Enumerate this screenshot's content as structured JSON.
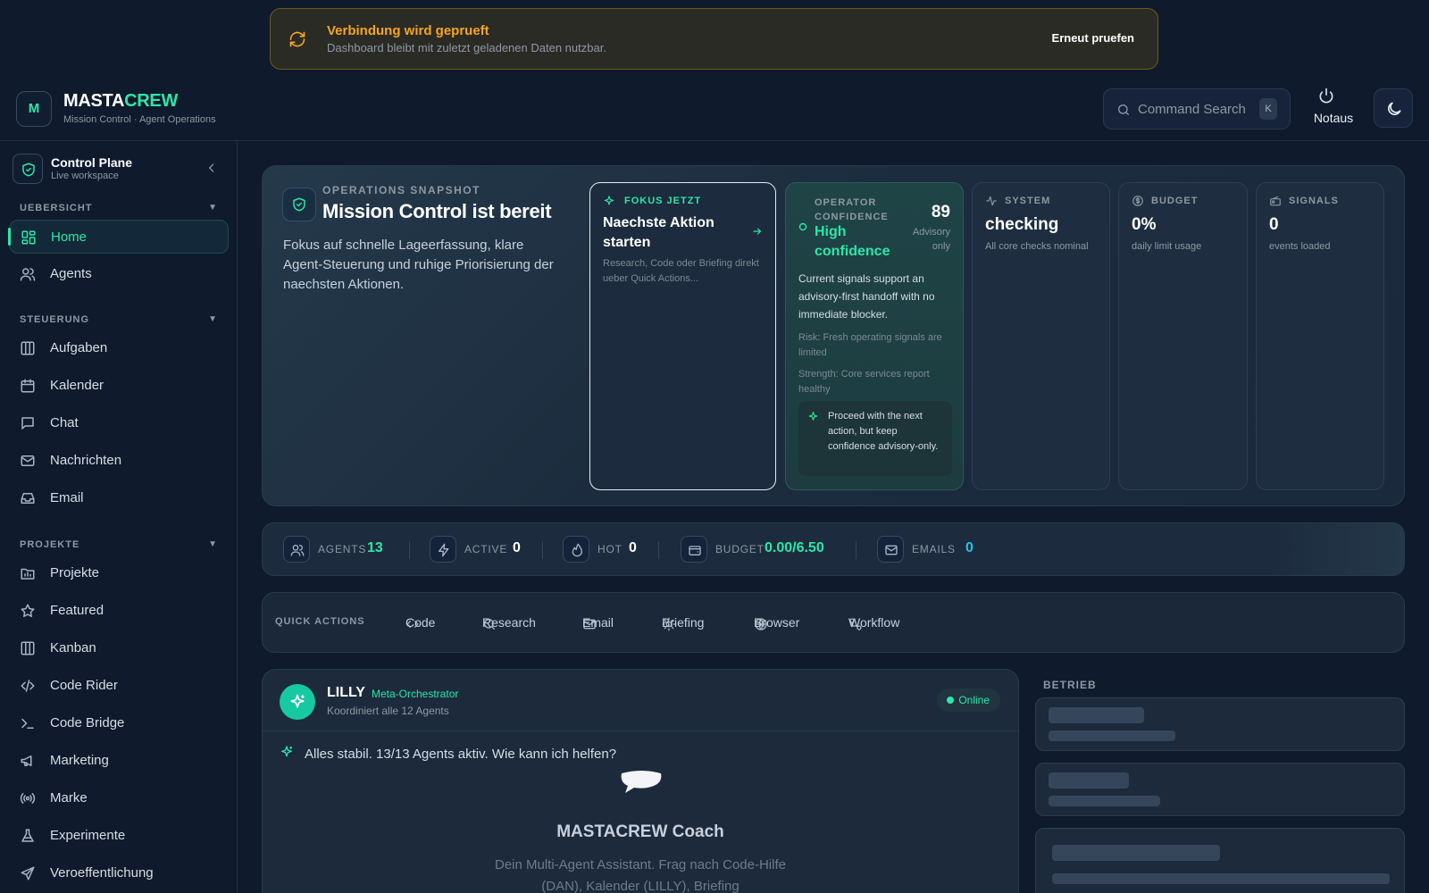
{
  "banner": {
    "title": "Verbindung wird geprueft",
    "subtitle": "Dashboard bleibt mit zuletzt geladenen Daten nutzbar.",
    "retry_label": "Erneut pruefen"
  },
  "header": {
    "logo_letter": "M",
    "brand_part1": "MASTA",
    "brand_part2": "CREW",
    "brand_sub": "Mission Control · Agent Operations",
    "search_placeholder": "Command Search",
    "search_shortcut": "K",
    "notaus_label": "Notaus"
  },
  "sidebar": {
    "workspace_title": "Control Plane",
    "workspace_sub": "Live workspace",
    "sections": [
      {
        "label": "UEBERSICHT",
        "items": [
          {
            "label": "Home",
            "icon": "grid-icon",
            "active": true
          },
          {
            "label": "Agents",
            "icon": "users-icon"
          }
        ]
      },
      {
        "label": "STEUERUNG",
        "items": [
          {
            "label": "Aufgaben",
            "icon": "columns-icon"
          },
          {
            "label": "Kalender",
            "icon": "calendar-icon"
          },
          {
            "label": "Chat",
            "icon": "chat-icon"
          },
          {
            "label": "Nachrichten",
            "icon": "mail-icon"
          },
          {
            "label": "Email",
            "icon": "inbox-icon"
          }
        ]
      },
      {
        "label": "PROJEKTE",
        "items": [
          {
            "label": "Projekte",
            "icon": "folder-chart-icon"
          },
          {
            "label": "Featured",
            "icon": "star-icon"
          },
          {
            "label": "Kanban",
            "icon": "columns-icon"
          },
          {
            "label": "Code Rider",
            "icon": "code-icon"
          },
          {
            "label": "Code Bridge",
            "icon": "terminal-icon"
          },
          {
            "label": "Marketing",
            "icon": "megaphone-icon"
          },
          {
            "label": "Marke",
            "icon": "broadcast-icon"
          },
          {
            "label": "Experimente",
            "icon": "flask-icon"
          },
          {
            "label": "Veroeffentlichung",
            "icon": "send-icon"
          }
        ]
      }
    ]
  },
  "snapshot": {
    "overline": "OPERATIONS SNAPSHOT",
    "title": "Mission Control ist bereit",
    "description": "Fokus auf schnelle Lageerfassung, klare Agent-Steuerung und ruhige Priorisierung der naechsten Aktionen.",
    "focus": {
      "overline": "FOKUS JETZT",
      "title": "Naechste Aktion starten",
      "sub": "Research, Code oder Briefing direkt ueber Quick Actions..."
    },
    "confidence": {
      "overline": "OPERATOR CONFIDENCE",
      "score": "89",
      "advisory": "Advisory only",
      "level": "High confidence",
      "body": "Current signals support an advisory-first handoff with no immediate blocker.",
      "risk": "Risk: Fresh operating signals are limited",
      "strength": "Strength: Core services report healthy",
      "tip": "Proceed with the next action, but keep confidence advisory-only."
    },
    "system": {
      "overline": "SYSTEM",
      "value": "checking",
      "caption": "All core checks nominal"
    },
    "budget": {
      "overline": "BUDGET",
      "value": "0%",
      "caption": "daily limit usage"
    },
    "signals": {
      "overline": "SIGNALS",
      "value": "0",
      "caption": "events loaded"
    }
  },
  "stats": [
    {
      "label": "AGENTS",
      "value": "13",
      "color": "#2ee6a8"
    },
    {
      "label": "ACTIVE",
      "value": "0",
      "color": "#ffffff"
    },
    {
      "label": "HOT",
      "value": "0",
      "color": "#ffffff"
    },
    {
      "label": "BUDGET",
      "value": "0.00/6.50",
      "color": "#2ee6a8"
    },
    {
      "label": "EMAILS",
      "value": "0",
      "color": "#22c4e8"
    }
  ],
  "quick_actions": {
    "label": "QUICK ACTIONS",
    "items": [
      "Code",
      "Research",
      "Email",
      "Briefing",
      "Browser",
      "Workflow"
    ]
  },
  "lilly": {
    "name": "LILLY",
    "role": "Meta-Orchestrator",
    "coordinates": "Koordiniert alle 12 Agents",
    "status": "Online",
    "message": "Alles stabil. 13/13 Agents aktiv. Wie kann ich helfen?",
    "coach_title": "MASTACREW Coach",
    "coach_desc": "Dein Multi-Agent Assistant. Frag nach Code-Hilfe (DAN), Kalender (LILLY), Briefing"
  },
  "betrieb": {
    "label": "BETRIEB"
  },
  "colors": {
    "accent": "#2ee6a8",
    "warning": "#f5a524",
    "background": "#0f1a2c"
  }
}
